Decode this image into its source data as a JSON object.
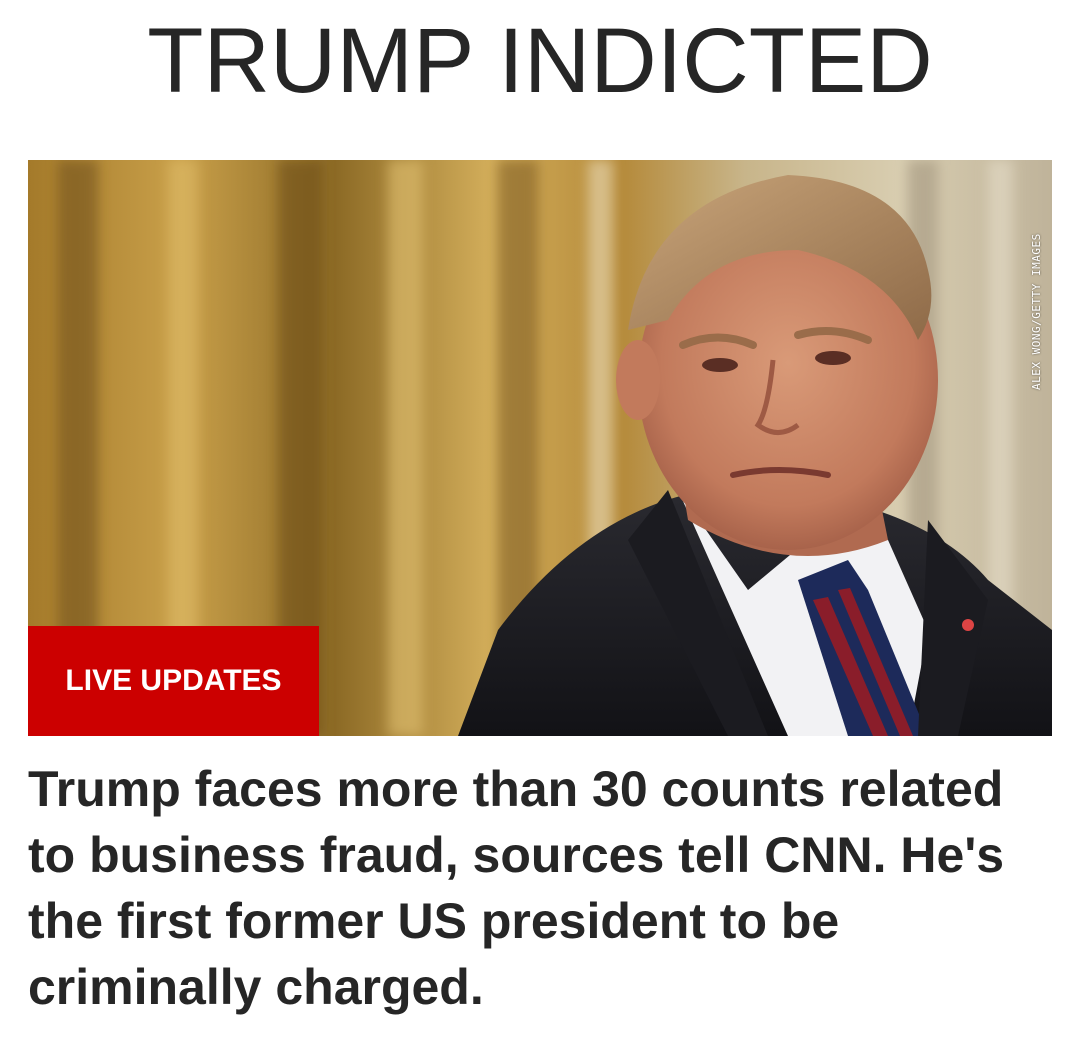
{
  "headline": "TRUMP INDICTED",
  "hero": {
    "photo_credit": "ALEX WONG/GETTY IMAGES",
    "badge": "LIVE UPDATES"
  },
  "summary": "Trump faces more than 30 counts related to business fraud, sources tell CNN. He's the first former US president to be criminally charged.",
  "colors": {
    "badge_red": "#cc0000",
    "text": "#262626",
    "background": "#ffffff"
  }
}
